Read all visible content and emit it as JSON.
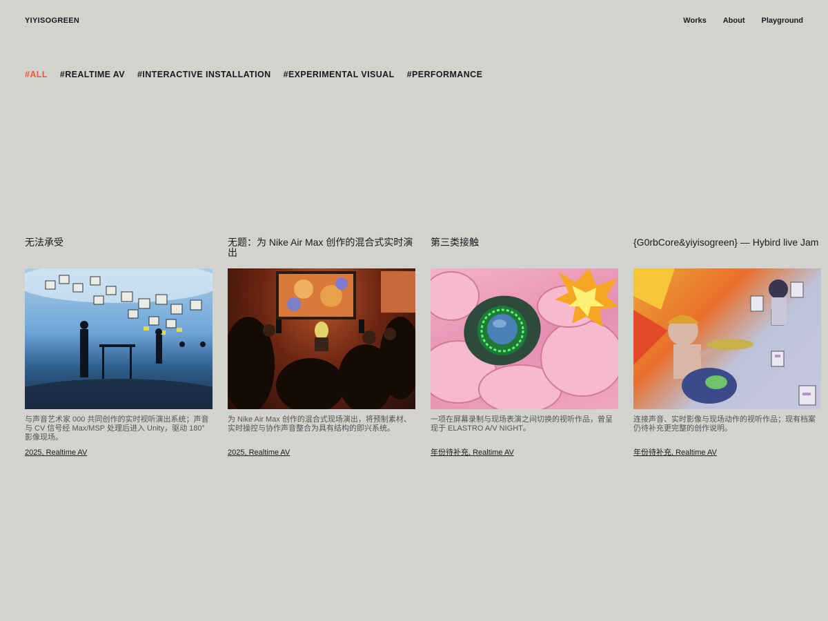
{
  "header": {
    "logo": "YIYISOGREEN",
    "nav": [
      "Works",
      "About",
      "Playground"
    ]
  },
  "filters": [
    {
      "label": "#ALL",
      "active": true
    },
    {
      "label": "#REALTIME AV",
      "active": false
    },
    {
      "label": "#INTERACTIVE INSTALLATION",
      "active": false
    },
    {
      "label": "#EXPERIMENTAL VISUAL",
      "active": false
    },
    {
      "label": "#PERFORMANCE",
      "active": false
    }
  ],
  "accent_color": "#ef5a3a",
  "background_color": "#d2d2cf",
  "works": [
    {
      "title": "无法承受",
      "description": "与声音艺术家 000 共同创作的实时视听演出系统；声音与 CV 信号经 Max/MSP 处理后进入 Unity，驱动 180° 影像现场。",
      "meta": "2025, Realtime AV"
    },
    {
      "title": "无题：为 Nike Air Max 创作的混合式实时演出",
      "description": "为 Nike Air Max 创作的混合式现场演出，将预制素材、实时操控与协作声音整合为具有结构的即兴系统。",
      "meta": "2025, Realtime AV"
    },
    {
      "title": "第三类接触",
      "description": "一项在屏幕录制与现场表演之间切换的视听作品，曾呈现于 ELASTRO A/V NIGHT。",
      "meta": "年份待补充, Realtime AV"
    },
    {
      "title": "{G0rbCore&yiyisogreen} — Hybird live Jam",
      "description": "连接声音、实时影像与现场动作的视听作品；现有档案仍待补充更完整的创作说明。",
      "meta": "年份待补充, Realtime AV"
    }
  ]
}
